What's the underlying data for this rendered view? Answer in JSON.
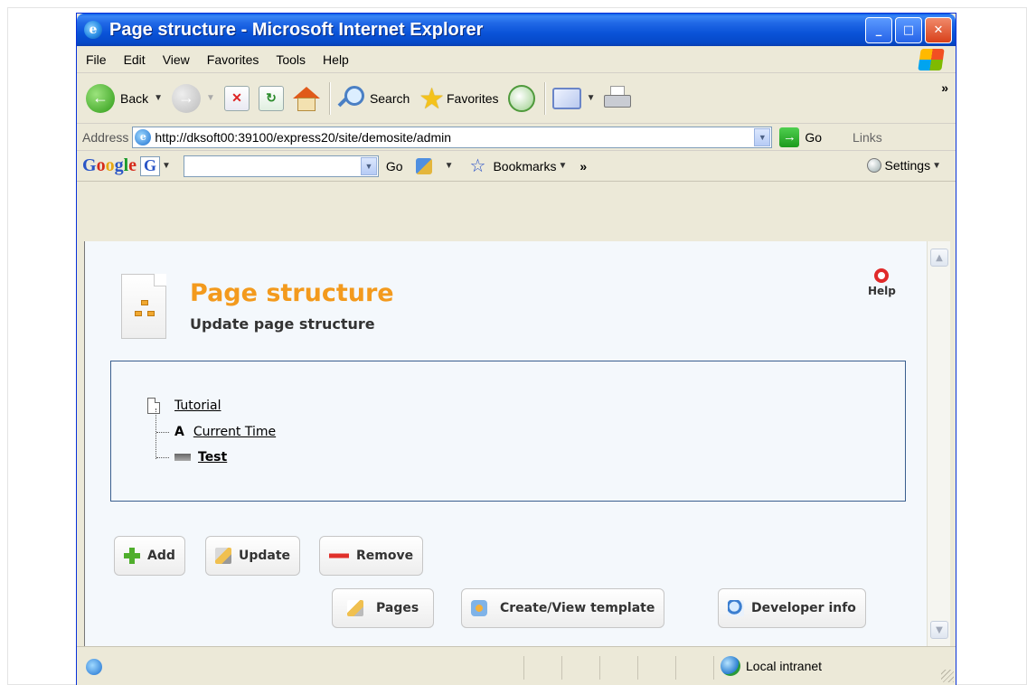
{
  "window": {
    "title": "Page structure - Microsoft Internet Explorer",
    "controls": {
      "minimize": "_",
      "maximize": "□",
      "close": "✕"
    }
  },
  "menu": {
    "items": [
      "File",
      "Edit",
      "View",
      "Favorites",
      "Tools",
      "Help"
    ]
  },
  "toolbar": {
    "back_label": "Back",
    "search_label": "Search",
    "favorites_label": "Favorites",
    "more": "»"
  },
  "address": {
    "label": "Address",
    "url": "http://dksoft00:39100/express20/site/demosite/admin",
    "go_label": "Go",
    "links_label": "Links"
  },
  "google_toolbar": {
    "logo": "Google",
    "go_label": "Go",
    "bookmarks_label": "Bookmarks",
    "more": "»",
    "settings_label": "Settings"
  },
  "page": {
    "title": "Page structure",
    "subtitle": "Update page structure",
    "help_label": "Help"
  },
  "tree": {
    "root": {
      "label": "Tutorial",
      "icon": "document-icon"
    },
    "children": [
      {
        "label": "Current Time",
        "icon": "text-a-icon",
        "bold": false
      },
      {
        "label": "Test",
        "icon": "bar-icon",
        "bold": true
      }
    ]
  },
  "actions": {
    "add": "Add",
    "update": "Update",
    "remove": "Remove",
    "pages": "Pages",
    "create_template": "Create/View template",
    "developer_info": "Developer info"
  },
  "status": {
    "zone": "Local intranet"
  }
}
